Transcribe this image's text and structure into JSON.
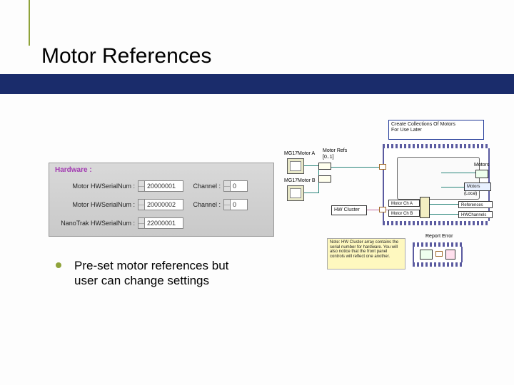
{
  "accent_color": "#8fa33a",
  "bar_color": "#1a2c6b",
  "title": "Motor References",
  "hardware": {
    "title": "Hardware :",
    "rows": [
      {
        "label": "Motor HWSerialNum :",
        "value": "20000001",
        "chan_label": "Channel :",
        "chan_value": "0"
      },
      {
        "label": "Motor HWSerialNum :",
        "value": "20000002",
        "chan_label": "Channel :",
        "chan_value": "0"
      },
      {
        "label": "NanoTrak HWSerialNum :",
        "value": "22000001",
        "chan_label": "",
        "chan_value": ""
      }
    ]
  },
  "bullet": "Pre-set motor references but user can change settings",
  "diagram": {
    "top_box": "Create Collections Of Motors\nFor Use Later",
    "motor_a": "MG17Motor A",
    "motor_b": "MG17Motor B",
    "motor_refs": "Motor Refs",
    "motor_refs_arr": "[0..1]",
    "hw_cluster": "HW Cluster",
    "motors_out": "Motors",
    "motors_sub": "Motors",
    "local": "(Local)",
    "refs_label": "References",
    "hwch_label": "HWChannels",
    "motor_cha": "Motor Ch A",
    "motor_chb": "Motor Ch B",
    "report_err": "Report Error",
    "yellow_note": "Note: HW Cluster array contains the serial number for hardware. You will also notice that the front panel controls will reflect one another."
  }
}
